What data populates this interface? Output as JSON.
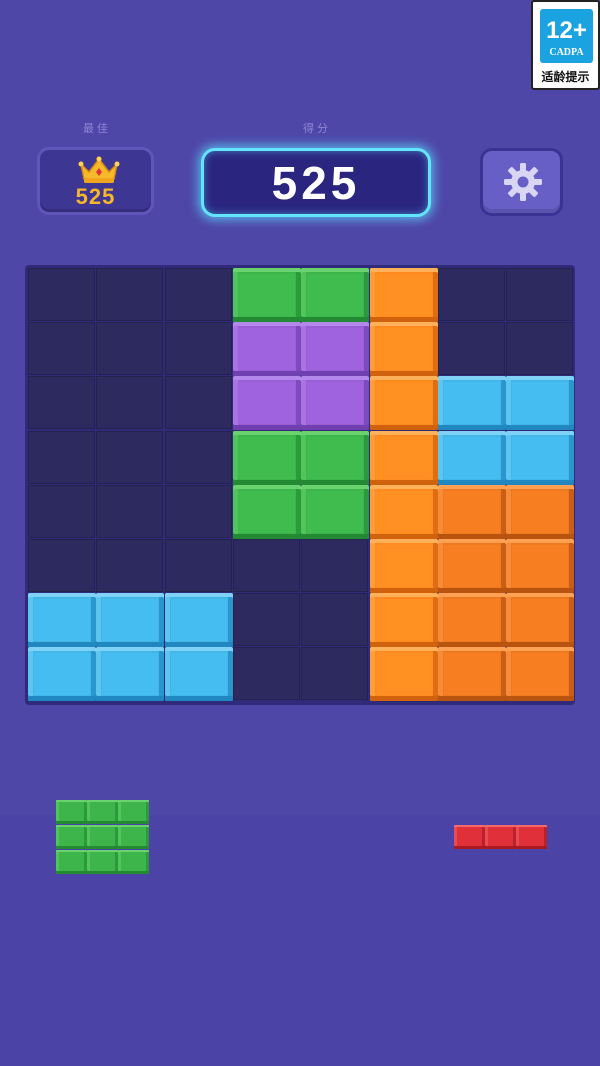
{
  "age_badge": {
    "rating": "12+",
    "org": "CADPA",
    "tip": "适龄提示"
  },
  "header": {
    "best_label": "最佳",
    "best_score": "525",
    "score_label": "得分",
    "score": "525",
    "settings_icon": "gear-icon",
    "crown_icon": "crown-icon"
  },
  "board": {
    "columns": 8,
    "rows": 8,
    "cells": [
      [
        null,
        null,
        null,
        "green",
        "green",
        "orange",
        null,
        null
      ],
      [
        null,
        null,
        null,
        "purple",
        "purple",
        "orange",
        null,
        null
      ],
      [
        null,
        null,
        null,
        "purple",
        "purple",
        "orange",
        "blue",
        "blue"
      ],
      [
        null,
        null,
        null,
        "green",
        "green",
        "orange",
        "blue",
        "blue"
      ],
      [
        null,
        null,
        null,
        "green",
        "green",
        "orange",
        "orange2",
        "orange2"
      ],
      [
        null,
        null,
        null,
        null,
        null,
        "orange",
        "orange2",
        "orange2"
      ],
      [
        "blue",
        "blue",
        "blue",
        null,
        null,
        "orange",
        "orange2",
        "orange2"
      ],
      [
        "blue",
        "blue",
        "blue",
        null,
        null,
        "orange",
        "orange2",
        "orange2"
      ]
    ]
  },
  "pieces": [
    {
      "name": "green-3x3-piece",
      "color": "green",
      "shape": [
        [
          1,
          1,
          1
        ],
        [
          1,
          1,
          1
        ],
        [
          1,
          1,
          1
        ]
      ]
    },
    {
      "name": "red-1x3-piece",
      "color": "red",
      "shape": [
        [
          1,
          1,
          1
        ]
      ]
    }
  ],
  "colors": {
    "background": "#4f47a8",
    "green": "#3db54a",
    "purple": "#9a5fd6",
    "orange": "#ff8a20",
    "blue": "#43b6e8",
    "red": "#e0303a",
    "score_glow": "#63e4ff",
    "best_gold": "#f5b62c"
  }
}
